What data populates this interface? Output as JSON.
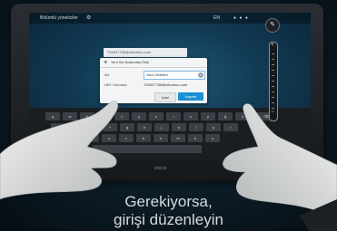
{
  "topbar": {
    "title": "Bölümlü yöneticiler",
    "time": "EN"
  },
  "dialog": {
    "background_address": "704537788@infocisco.com",
    "title": "Yeni Sık Kullanılan Ekle",
    "name_label": "Ad",
    "name_value": "John Deleted",
    "uri_label": "URI / Numara",
    "uri_value": "704537788@infocisco.com",
    "cancel_label": "İptal",
    "save_label": "Kaydet"
  },
  "keyboard": {
    "row1": [
      "q",
      "w",
      "e",
      "r",
      "t",
      "y",
      "u",
      "ı",
      "o",
      "p",
      "ğ",
      "ü"
    ],
    "row2": [
      "a",
      "s",
      "d",
      "f",
      "g",
      "h",
      "j",
      "k",
      "l",
      "ş",
      "i"
    ],
    "row3": [
      "z",
      "x",
      "c",
      "v",
      "b",
      "n",
      "m",
      "ö",
      "ç"
    ]
  },
  "caption": {
    "line1": "Gerekiyorsa,",
    "line2": "girişi düzenleyin"
  },
  "brand": "cisco",
  "colors": {
    "accent": "#1a8fd6",
    "screen": "#1f5a7a"
  }
}
